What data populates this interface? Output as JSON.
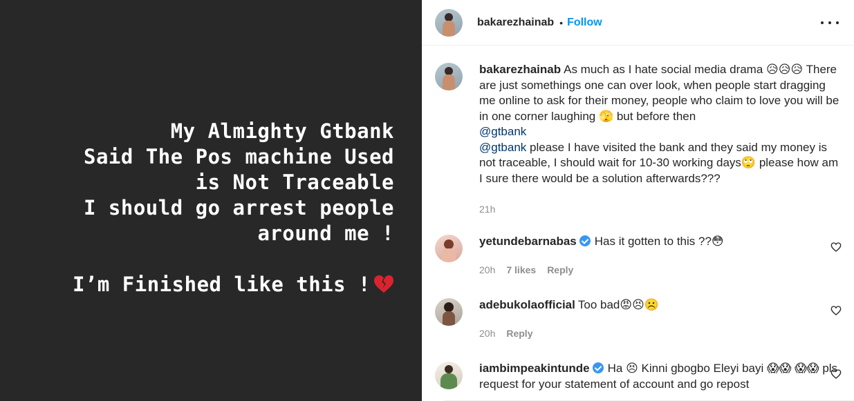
{
  "story": {
    "lines": [
      "My Almighty Gtbank",
      "Said The Pos machine Used",
      "is Not Traceable",
      "I should go arrest people",
      "around me !"
    ],
    "last_line": "I’m Finished like this !",
    "heart_icon": "broken-heart-icon"
  },
  "header": {
    "username": "bakarezhainab",
    "dot": "•",
    "follow_label": "Follow"
  },
  "caption": {
    "username": "bakarezhainab",
    "text1": "As much as I hate social media drama 😥😥😥 There are just somethings one can over look, when people start dragging me online to ask for their money, people who claim to love you will be in one corner laughing 🫣 but before then",
    "mention1": "@gtbank",
    "mention2": "@gtbank",
    "text2": " please I have visited the bank and they said my money is not traceable, I should wait for 10-30 working days🙄 please how am I sure there would be a solution afterwards???",
    "time": "21h"
  },
  "comments": [
    {
      "username": "yetundebarnabas",
      "verified": true,
      "text": "Has it gotten to this ??😳",
      "time": "20h",
      "likes": "7 likes",
      "reply": "Reply"
    },
    {
      "username": "adebukolaofficial",
      "verified": false,
      "text": "Too bad😡😣☹️",
      "time": "20h",
      "reply": "Reply"
    },
    {
      "username": "iambimpeakintunde",
      "verified": true,
      "text": "Ha 😣 Kinni gbogbo Eleyi bayi 😱😱 😱😱 pls request for your statement of account and go repost"
    }
  ],
  "colors": {
    "story_bg": "#282828",
    "follow": "#0095f6",
    "meta": "#8e8e8e",
    "verified": "#3897f0"
  }
}
